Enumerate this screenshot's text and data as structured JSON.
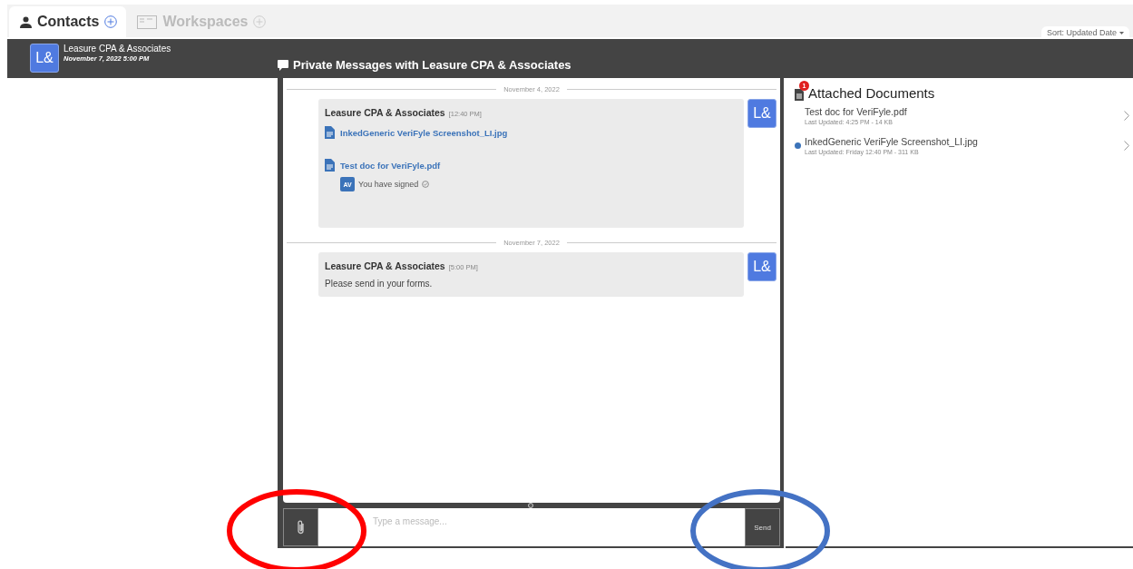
{
  "tabs": [
    {
      "label": "Contacts",
      "selected": true
    },
    {
      "label": "Workspaces",
      "selected": false
    }
  ],
  "sort": {
    "label": "Sort: Updated Date"
  },
  "contacts": [
    {
      "avatar": "L&",
      "name": "Leasure CPA & Associates",
      "date": "November 7, 2022 5:00 PM",
      "selected": true
    }
  ],
  "conversation": {
    "title": "Private Messages with Leasure CPA & Associates",
    "groups": [
      {
        "date": "November 4, 2022",
        "messages": [
          {
            "sender": "Leasure CPA & Associates",
            "time": "[12:40 PM]",
            "avatar": "L&",
            "files": [
              {
                "name": "InkedGeneric VeriFyle Screenshot_LI.jpg"
              },
              {
                "name": "Test doc for VeriFyle.pdf",
                "signature": {
                  "avatar": "AV",
                  "text": "You have signed"
                }
              }
            ]
          }
        ]
      },
      {
        "date": "November 7, 2022",
        "messages": [
          {
            "sender": "Leasure CPA & Associates",
            "time": "[5:00 PM]",
            "avatar": "L&",
            "text": "Please send in your forms."
          }
        ]
      }
    ],
    "composer": {
      "placeholder": "Type a message...",
      "send": "Send"
    }
  },
  "documents": {
    "title": "Attached Documents",
    "badge": "1",
    "items": [
      {
        "name": "Test doc for VeriFyle.pdf",
        "meta": "Last Updated: 4:25 PM - 14 KB",
        "unread": false
      },
      {
        "name": "InkedGeneric VeriFyle Screenshot_LI.jpg",
        "meta": "Last Updated: Friday 12:40 PM - 311 KB",
        "unread": true
      }
    ]
  },
  "annotations": [
    {
      "kind": "ellipse",
      "color": "#ff0000"
    },
    {
      "kind": "ellipse",
      "color": "#4472c4"
    }
  ]
}
